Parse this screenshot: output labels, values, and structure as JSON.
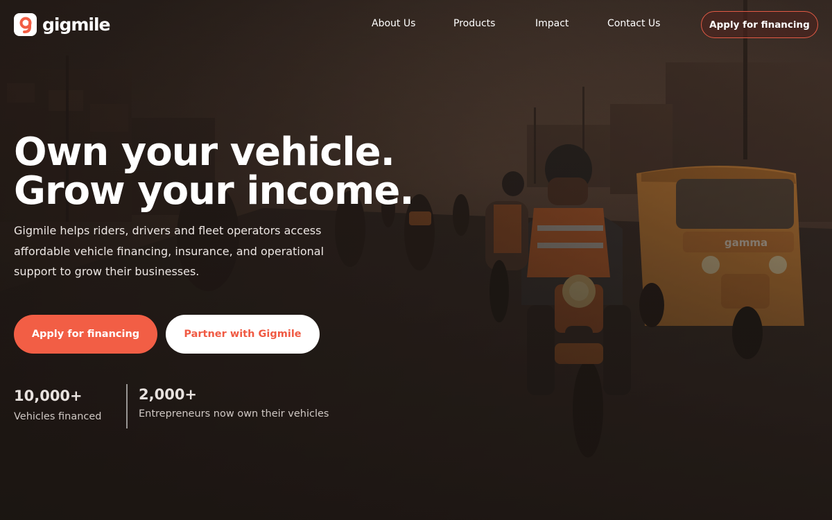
{
  "brand": {
    "name": "gigmile"
  },
  "nav": {
    "items": [
      {
        "label": "About Us"
      },
      {
        "label": "Products"
      },
      {
        "label": "Impact"
      },
      {
        "label": "Contact Us"
      }
    ],
    "cta_label": "Apply for financing"
  },
  "hero": {
    "headline_line1": "Own your vehicle.",
    "headline_line2": "Grow your income.",
    "subtext": "Gigmile helps riders, drivers and fleet operators access affordable vehicle financing, insurance, and operational support to grow their businesses.",
    "primary_cta": "Apply for financing",
    "secondary_cta": "Partner with Gigmile",
    "tricycle_brand": "gamma"
  },
  "stats": [
    {
      "value": "10,000+",
      "label": "Vehicles financed"
    },
    {
      "value": "2,000+",
      "label": "Entrepreneurs now own their vehicles"
    }
  ],
  "colors": {
    "accent": "#f25e45",
    "overlay": "#2a211c",
    "text": "#ffffff"
  },
  "icons": {
    "logo": "gigmile-logo-icon"
  }
}
